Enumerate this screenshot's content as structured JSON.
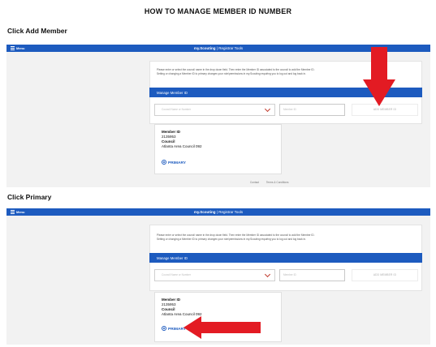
{
  "document_title": "HOW TO MANAGE MEMBER ID NUMBER",
  "steps": [
    {
      "label": "Click Add Member",
      "app": {
        "menu_label": "Menu",
        "brand": "my.Scouting",
        "brand_section": "| Registrar Tools",
        "instructions_line1": "Please enter or select the council name in the drop down field. Then enter the Member ID associated to the council to add the Member ID.",
        "instructions_line2": "Setting or changing a Member ID to primary changes your role/permissions in my.Scouting requiring you to log out and log back in.",
        "section_title": "Manage Member ID",
        "council_placeholder": "Council Name or Number",
        "member_id_placeholder": "Member ID",
        "add_button_label": "ADD MEMBER ID",
        "card": {
          "member_id_label": "Member ID",
          "member_id_value": "2135953",
          "council_label": "Council",
          "council_value": "Atlanta Area Council 092",
          "primary_label": "PRIMARY"
        },
        "footer_links": [
          "Contact",
          "Terms & Conditions"
        ]
      },
      "pointer_arrow_color": "#e31b23"
    },
    {
      "label": "Click Primary",
      "app": {
        "menu_label": "Menu",
        "brand": "my.Scouting",
        "brand_section": "| Registrar Tools",
        "instructions_line1": "Please enter or select the council name in the drop down field. Then enter the Member ID associated to the council to add the Member ID.",
        "instructions_line2": "Setting or changing a Member ID to primary changes your role/permissions in my.Scouting requiring you to log out and log back in.",
        "section_title": "Manage Member ID",
        "council_placeholder": "Council Name or Number",
        "member_id_placeholder": "Member ID",
        "add_button_label": "ADD MEMBER ID",
        "card": {
          "member_id_label": "Member ID",
          "member_id_value": "2135953",
          "council_label": "Council",
          "council_value": "Atlanta Area Council 092",
          "primary_label": "PRIMARY"
        }
      },
      "pointer_arrow_color": "#e31b23"
    }
  ],
  "colors": {
    "brand_blue": "#1d5bbf",
    "arrow_red": "#e31b23"
  }
}
